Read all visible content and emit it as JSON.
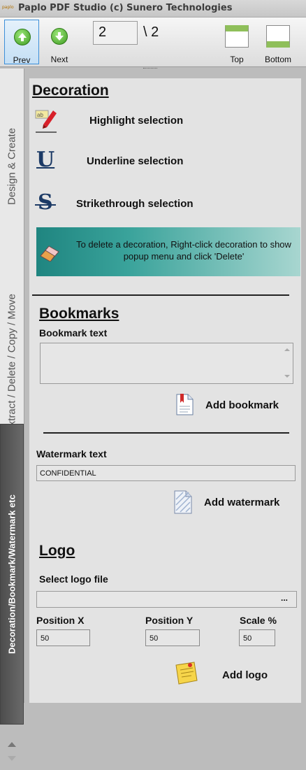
{
  "window": {
    "app_logo_text": "paplo",
    "title": "Paplo PDF Studio (c) Sunero Technologies"
  },
  "toolbar": {
    "prev_label": "Prev",
    "next_label": "Next",
    "page_value": "2",
    "page_total": "\\ 2",
    "top_label": "Top",
    "bottom_label": "Bottom"
  },
  "tabs": [
    {
      "label": "Design & Create",
      "active": false
    },
    {
      "label": "Split / Extract / Delete / Copy / Move",
      "active": false
    },
    {
      "label": "Decoration/Bookmark/Watermark etc",
      "active": true
    }
  ],
  "decoration": {
    "title": "Decoration",
    "highlight_label": "Highlight selection",
    "underline_icon_glyph": "U",
    "underline_label": "Underline selection",
    "strikethrough_icon_glyph": "S",
    "strikethrough_label": "Strikethrough selection",
    "info_text": "To delete a decoration, Right-click decoration to show popup menu and click 'Delete'"
  },
  "bookmarks": {
    "title": "Bookmarks",
    "text_label": "Bookmark text",
    "text_value": "",
    "add_label": "Add bookmark"
  },
  "watermark": {
    "text_label": "Watermark text",
    "text_value": "CONFIDENTIAL",
    "add_label": "Add watermark"
  },
  "logo": {
    "title": "Logo",
    "file_label": "Select logo file",
    "browse_label": "...",
    "position_x_label": "Position X",
    "position_y_label": "Position Y",
    "scale_label": "Scale %",
    "position_x_value": "50",
    "position_y_value": "50",
    "scale_value": "50",
    "add_label": "Add logo"
  },
  "colors": {
    "accent_green": "#3e9a20",
    "info_box": "#1f8580",
    "active_tab": "#555555"
  }
}
